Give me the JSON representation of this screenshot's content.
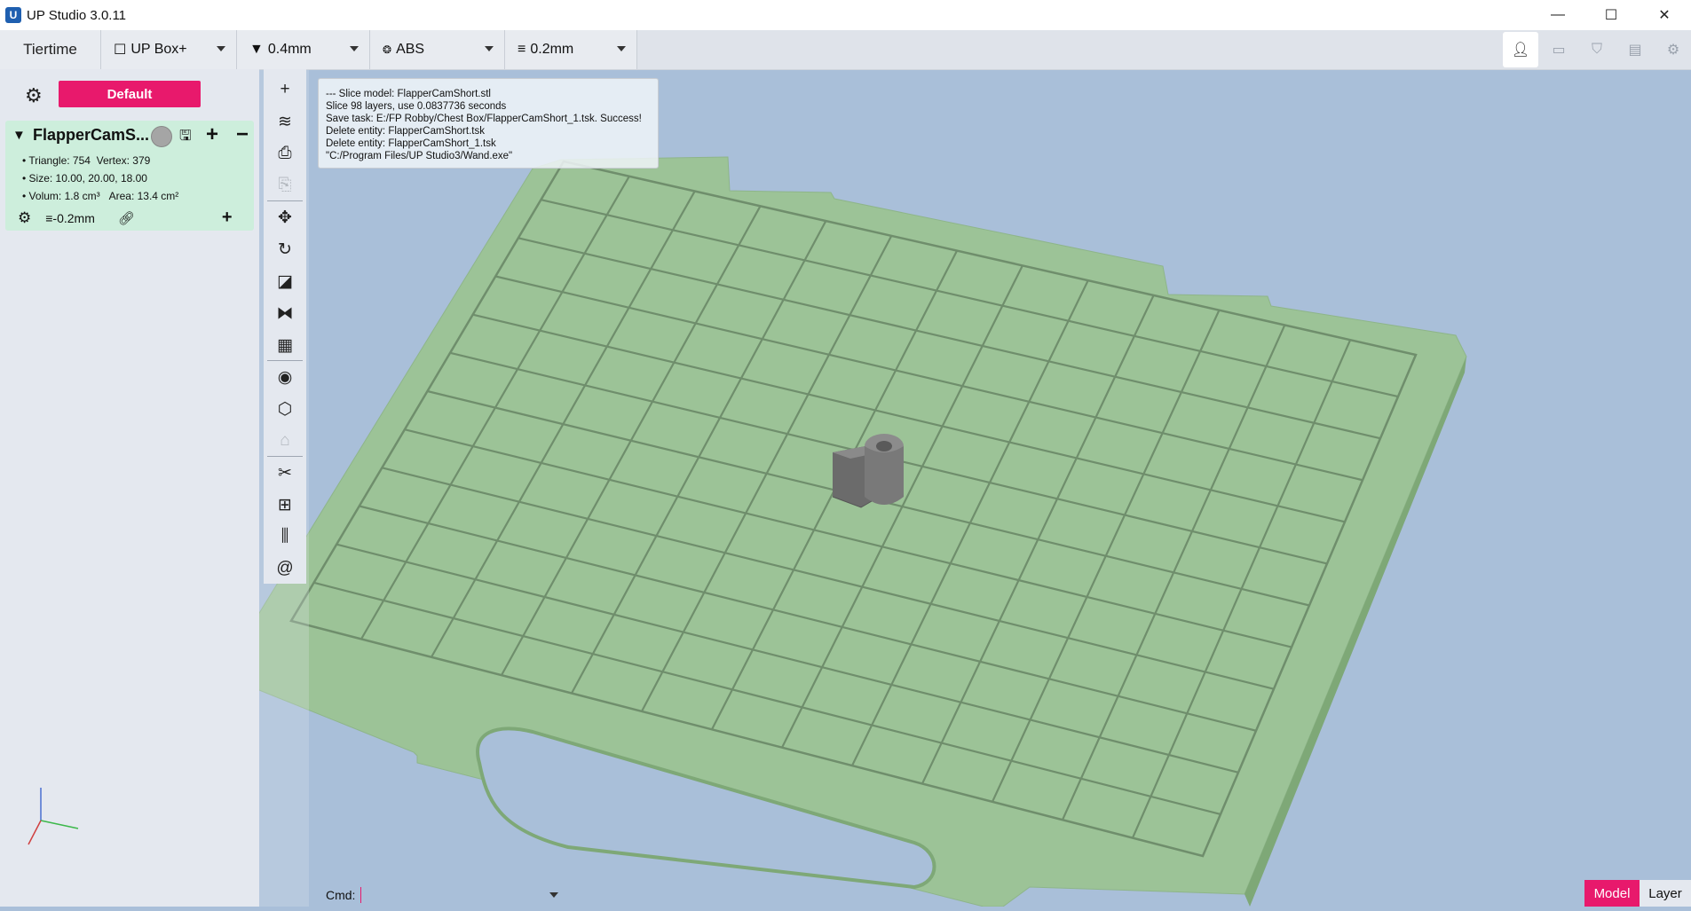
{
  "window": {
    "title": "UP Studio 3.0.11",
    "logo_glyph": "U",
    "minimize_glyph": "—",
    "maximize_glyph": "☐",
    "close_glyph": "✕"
  },
  "toolbar": {
    "brand": "Tiertime",
    "printer": "UP Box+",
    "nozzle": "0.4mm",
    "material": "ABS",
    "layer": "0.2mm",
    "right_icons": [
      "user-icon",
      "printer-icon",
      "shirt-icon",
      "document-icon",
      "settings-icon"
    ]
  },
  "left_panel": {
    "profile_button": "Default",
    "model": {
      "name": "FlapperCamS...",
      "color": "#a5a5a5",
      "triangle_label": "Triangle: 754",
      "vertex_label": "Vertex: 379",
      "size_label": "Size: 10.00, 20.00, 18.00",
      "volume_label": "Volum: 1.8 cm³",
      "area_label": "Area: 13.4 cm²",
      "layer_setting": "≡-0.2mm"
    }
  },
  "side_tools": [
    {
      "name": "add-icon",
      "glyph": "+",
      "enabled": true
    },
    {
      "name": "layers-icon",
      "glyph": "≋",
      "enabled": true
    },
    {
      "name": "preview-icon",
      "glyph": "⎙",
      "enabled": true
    },
    {
      "name": "print-icon",
      "glyph": "⎘",
      "enabled": false
    },
    {
      "name": "move-icon",
      "glyph": "✥",
      "enabled": true
    },
    {
      "name": "rotate-icon",
      "glyph": "↻",
      "enabled": true
    },
    {
      "name": "scale-icon",
      "glyph": "◪",
      "enabled": true
    },
    {
      "name": "mirror-icon",
      "glyph": "⧓",
      "enabled": true
    },
    {
      "name": "place-icon",
      "glyph": "▦",
      "enabled": true
    },
    {
      "name": "view-icon",
      "glyph": "◉",
      "enabled": true
    },
    {
      "name": "cube-icon",
      "glyph": "⬡",
      "enabled": true
    },
    {
      "name": "support-icon",
      "glyph": "⌂",
      "enabled": false
    },
    {
      "name": "repair-icon",
      "glyph": "✂",
      "enabled": true
    },
    {
      "name": "arrange-icon",
      "glyph": "⊞",
      "enabled": true
    },
    {
      "name": "raft-icon",
      "glyph": "⫼",
      "enabled": true
    },
    {
      "name": "calibrate-icon",
      "glyph": "@",
      "enabled": true
    }
  ],
  "log": [
    " --- Slice model: FlapperCamShort.stl",
    "Slice 98 layers, use 0.0837736 seconds",
    "Save task: E:/FP Robby/Chest Box/FlapperCamShort_1.tsk. Success!",
    "Delete entity: FlapperCamShort.tsk",
    "Delete entity: FlapperCamShort_1.tsk",
    "\"C:/Program Files/UP Studio3/Wand.exe\""
  ],
  "cmd": {
    "label": "Cmd:",
    "value": ""
  },
  "view_tabs": {
    "model": "Model",
    "layer": "Layer"
  },
  "colors": {
    "accent": "#e8196c",
    "platform": "#9cc397",
    "background": "#a9bfd9",
    "model_card": "#cdeedc"
  }
}
